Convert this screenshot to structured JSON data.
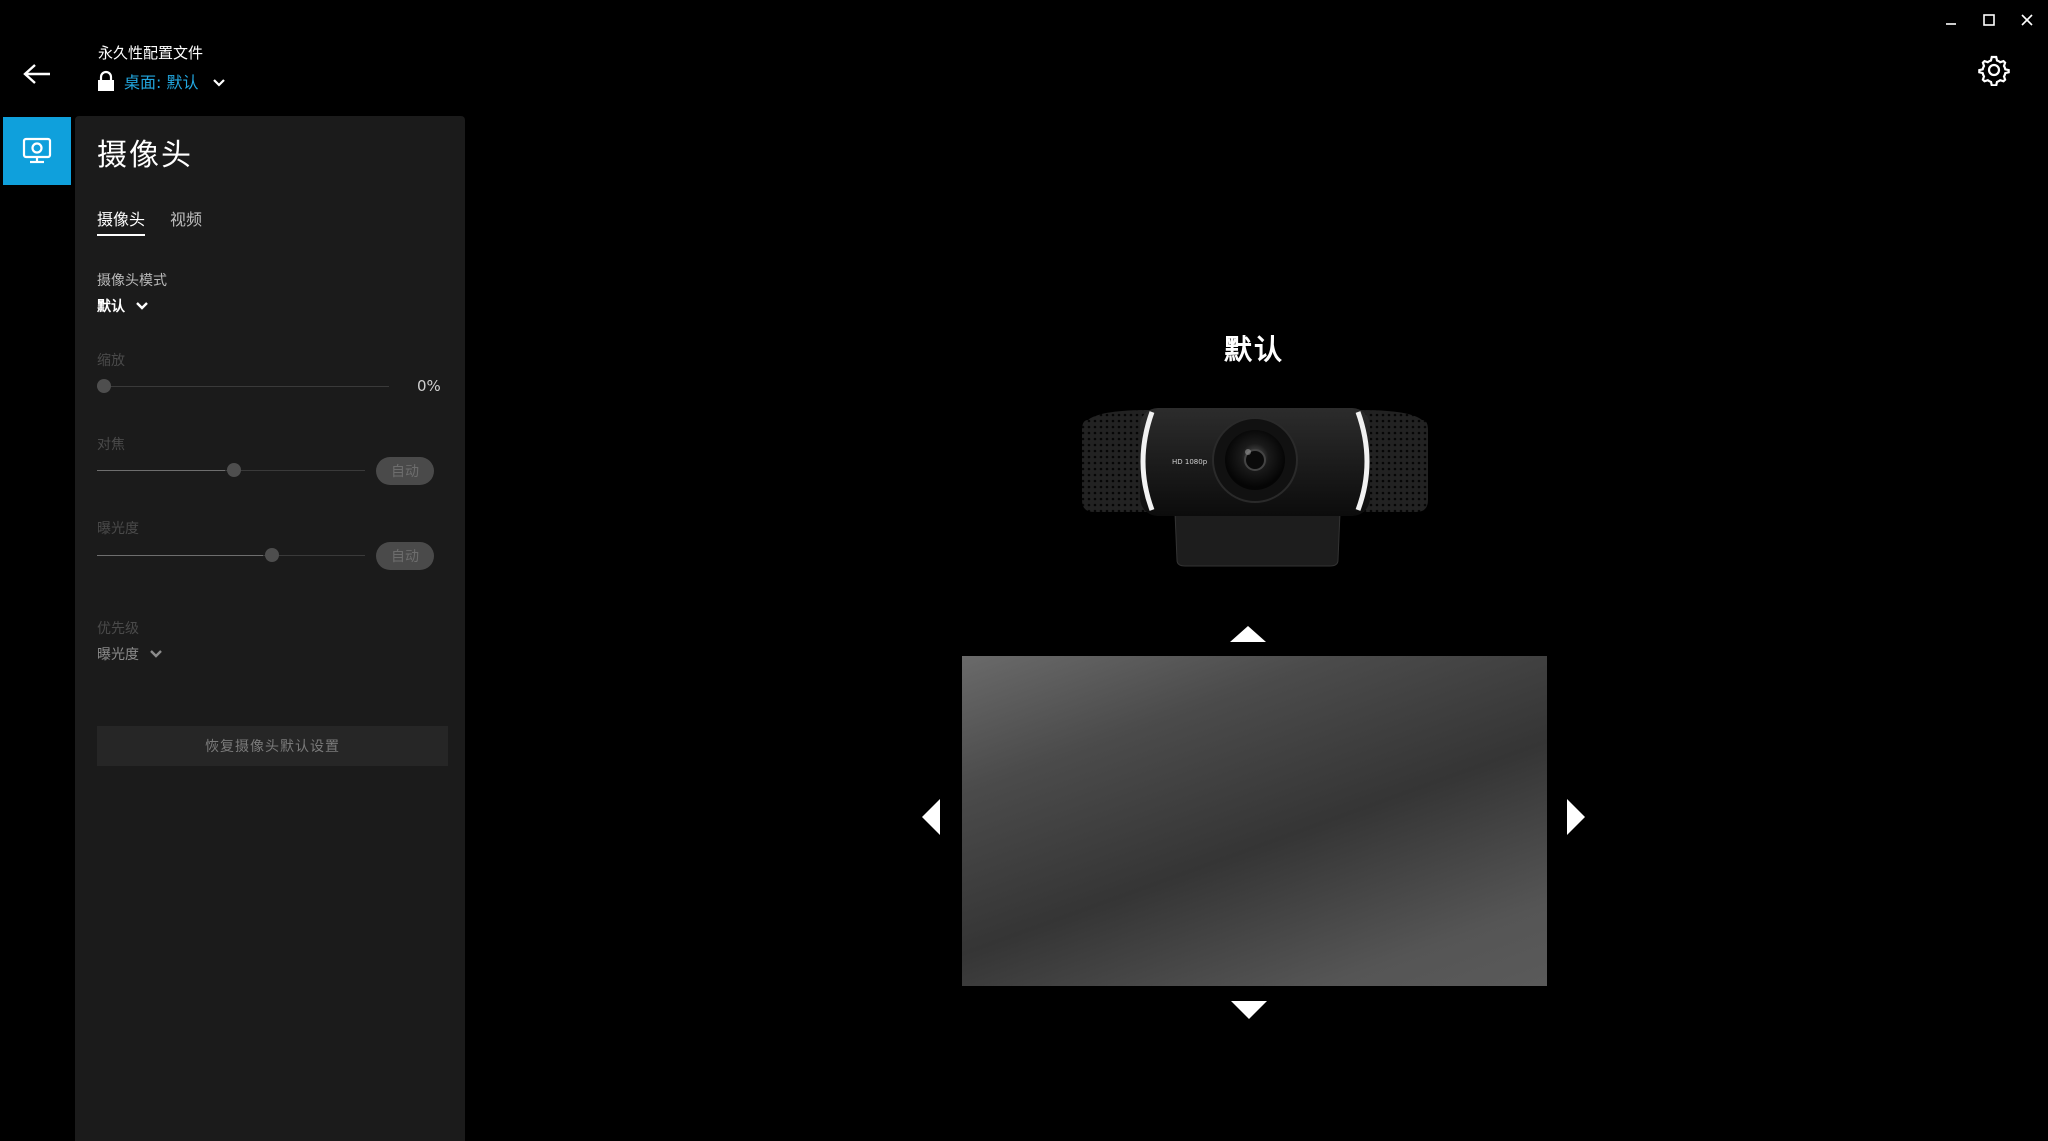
{
  "window": {
    "minimize_icon": "minimize-icon",
    "maximize_icon": "maximize-icon",
    "close_icon": "close-icon"
  },
  "header": {
    "profile_title": "永久性配置文件",
    "profile_name": "桌面: 默认",
    "accent_color": "#22a7e0"
  },
  "sidebar": {
    "active_item_icon": "webcam-icon",
    "active_color": "#0fa0dc"
  },
  "panel": {
    "title": "摄像头",
    "tabs": [
      {
        "label": "摄像头",
        "active": true
      },
      {
        "label": "视频",
        "active": false
      }
    ],
    "camera_mode": {
      "label": "摄像头模式",
      "value": "默认"
    },
    "zoom": {
      "label": "缩放",
      "value_text": "0%",
      "level": 0
    },
    "focus": {
      "label": "对焦",
      "auto_label": "自动",
      "level": 0.46
    },
    "exposure": {
      "label": "曝光度",
      "auto_label": "自动",
      "level": 0.6
    },
    "priority": {
      "label": "优先级",
      "value": "曝光度"
    },
    "reset_label": "恢复摄像头默认设置"
  },
  "main": {
    "mode_title": "默认",
    "webcam_badge": "HD 1080p"
  }
}
